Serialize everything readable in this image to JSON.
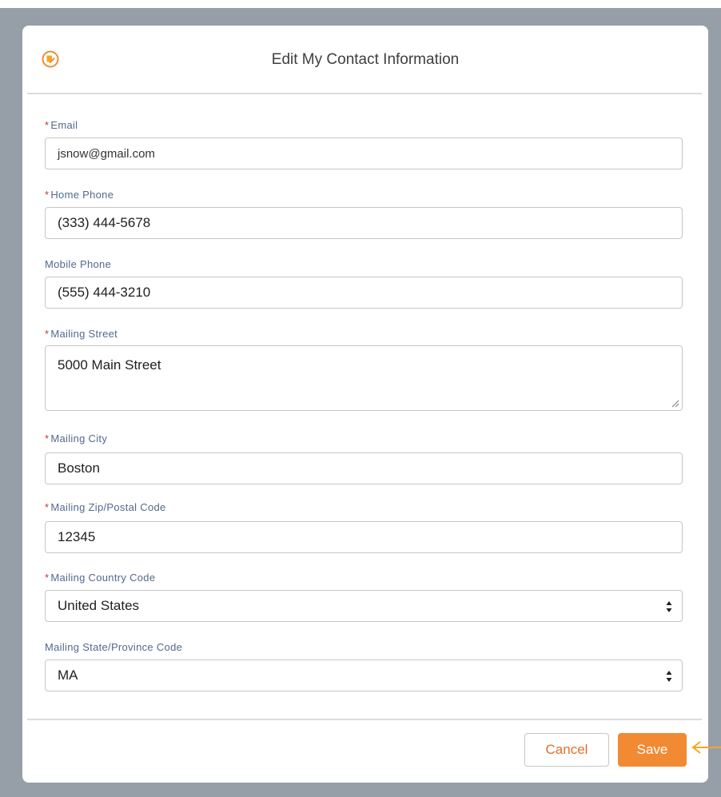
{
  "modal": {
    "title": "Edit My Contact Information",
    "icon": "edit-icon",
    "accent_color": "#f18a33"
  },
  "fields": {
    "email": {
      "label": "Email",
      "required": true,
      "value": "jsnow@gmail.com"
    },
    "home_phone": {
      "label": "Home Phone",
      "required": true,
      "value": "(333) 444-5678"
    },
    "mobile_phone": {
      "label": "Mobile Phone",
      "required": false,
      "value": "(555) 444-3210"
    },
    "mailing_street": {
      "label": "Mailing Street",
      "required": true,
      "value": "5000 Main Street"
    },
    "mailing_city": {
      "label": "Mailing City",
      "required": true,
      "value": "Boston"
    },
    "mailing_zip": {
      "label": "Mailing Zip/Postal Code",
      "required": true,
      "value": "12345"
    },
    "mailing_country": {
      "label": "Mailing Country Code",
      "required": true,
      "value": "United States"
    },
    "mailing_state": {
      "label": "Mailing State/Province Code",
      "required": false,
      "value": "MA"
    }
  },
  "required_marker": "*",
  "footer": {
    "cancel_label": "Cancel",
    "save_label": "Save"
  }
}
